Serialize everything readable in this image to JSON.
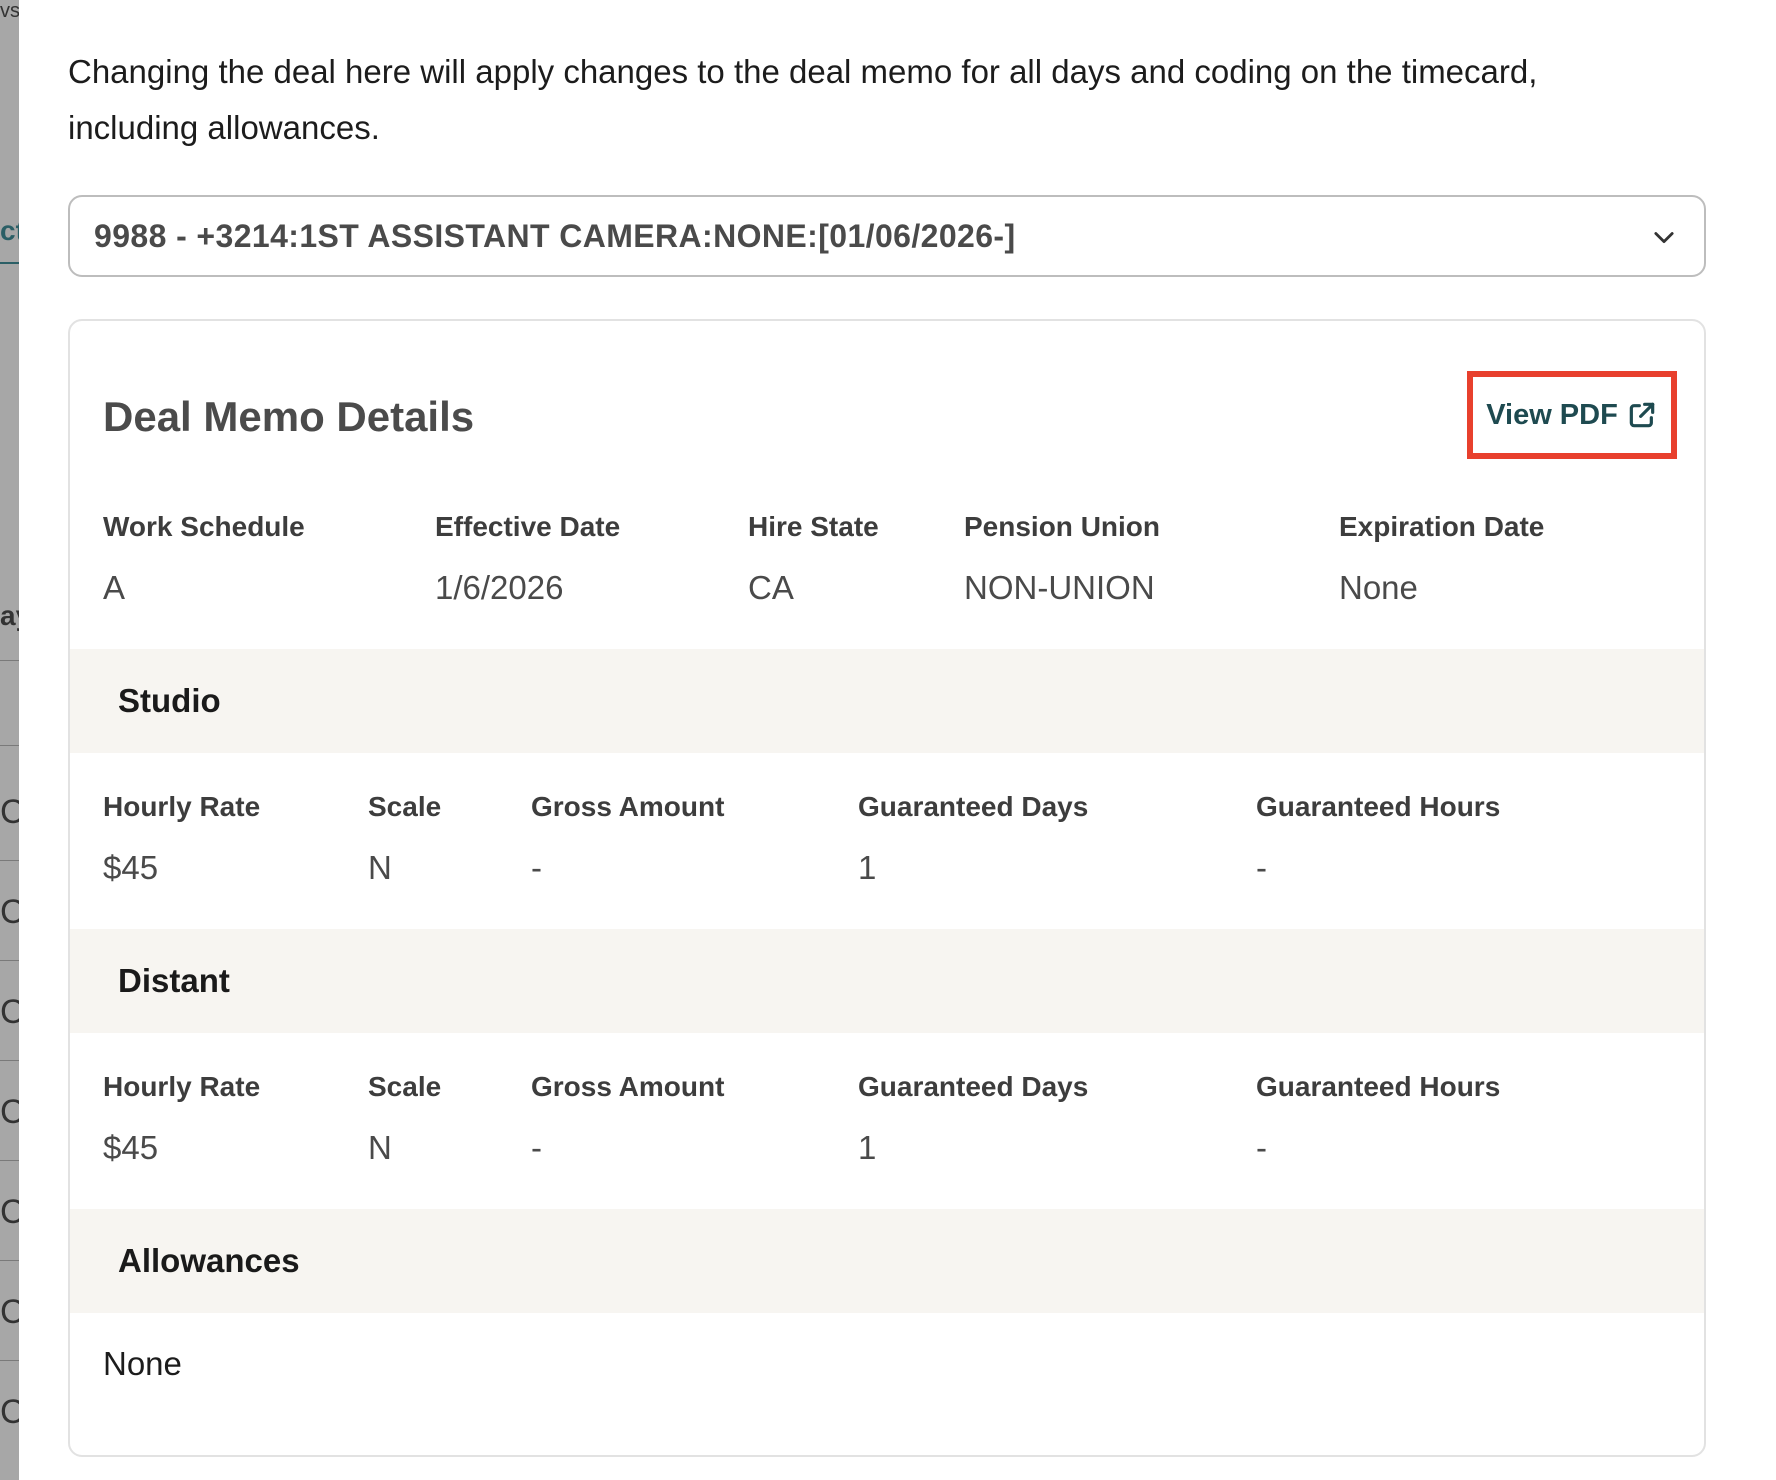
{
  "background_fragments": [
    "vs",
    "ct",
    "ay",
    "C",
    "C",
    "C",
    "C",
    "C",
    "C",
    "C"
  ],
  "modal": {
    "intro_text": "Changing the deal here will apply changes to the deal memo for all days and coding on the timecard, including allowances.",
    "deal_select": {
      "value": "9988 - +3214:1ST ASSISTANT CAMERA:NONE:[01/06/2026-]",
      "icon": "chevron-down-icon"
    },
    "card": {
      "title": "Deal Memo Details",
      "view_pdf": {
        "label": "View PDF",
        "icon": "external-link-icon"
      },
      "summary": [
        {
          "label": "Work Schedule",
          "value": "A"
        },
        {
          "label": "Effective Date",
          "value": "1/6/2026"
        },
        {
          "label": "Hire State",
          "value": "CA"
        },
        {
          "label": "Pension Union",
          "value": "NON-UNION"
        },
        {
          "label": "Expiration Date",
          "value": "None"
        }
      ],
      "studio": {
        "title": "Studio",
        "fields": [
          {
            "label": "Hourly Rate",
            "value": "$45"
          },
          {
            "label": "Scale",
            "value": "N"
          },
          {
            "label": "Gross Amount",
            "value": "-"
          },
          {
            "label": "Guaranteed Days",
            "value": "1"
          },
          {
            "label": "Guaranteed Hours",
            "value": "-"
          }
        ]
      },
      "distant": {
        "title": "Distant",
        "fields": [
          {
            "label": "Hourly Rate",
            "value": "$45"
          },
          {
            "label": "Scale",
            "value": "N"
          },
          {
            "label": "Gross Amount",
            "value": "-"
          },
          {
            "label": "Guaranteed Days",
            "value": "1"
          },
          {
            "label": "Guaranteed Hours",
            "value": "-"
          }
        ]
      },
      "allowances": {
        "title": "Allowances",
        "value": "None"
      }
    }
  },
  "colors": {
    "highlight_border": "#e8402d",
    "link_text": "#1e4a50",
    "section_band": "#f7f5f1"
  }
}
